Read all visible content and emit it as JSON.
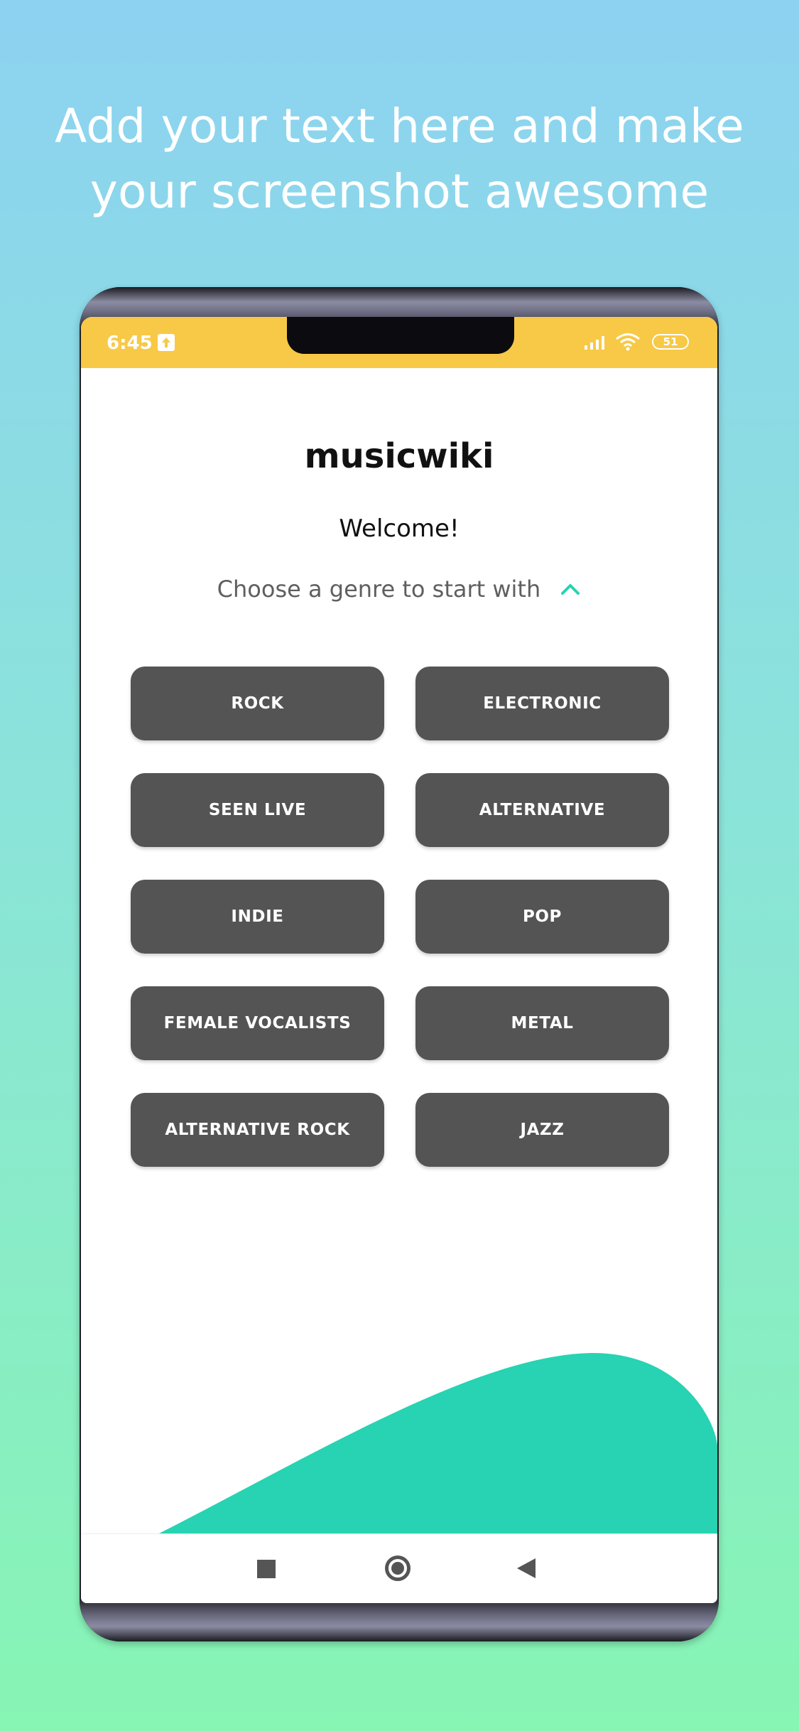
{
  "headline": {
    "line1": "Add your text here and make",
    "line2": "your screenshot awesome"
  },
  "status_bar": {
    "time": "6:45",
    "battery": "51",
    "icons": [
      "upload-icon",
      "signal-icon",
      "wifi-icon",
      "battery-icon"
    ]
  },
  "app": {
    "title": "musicwiki",
    "welcome": "Welcome!",
    "prompt": "Choose a genre to start with",
    "prompt_icon": "chevron-up-icon"
  },
  "genres": [
    "ROCK",
    "ELECTRONIC",
    "SEEN LIVE",
    "ALTERNATIVE",
    "INDIE",
    "POP",
    "FEMALE VOCALISTS",
    "METAL",
    "ALTERNATIVE ROCK",
    "JAZZ"
  ],
  "nav_bar": {
    "icons": [
      "square-icon",
      "home-circle-icon",
      "back-triangle-icon"
    ]
  },
  "colors": {
    "status_bar": "#f8c946",
    "accent": "#27d3b2",
    "genre_button": "#545454",
    "headline_text": "#ffffff"
  }
}
